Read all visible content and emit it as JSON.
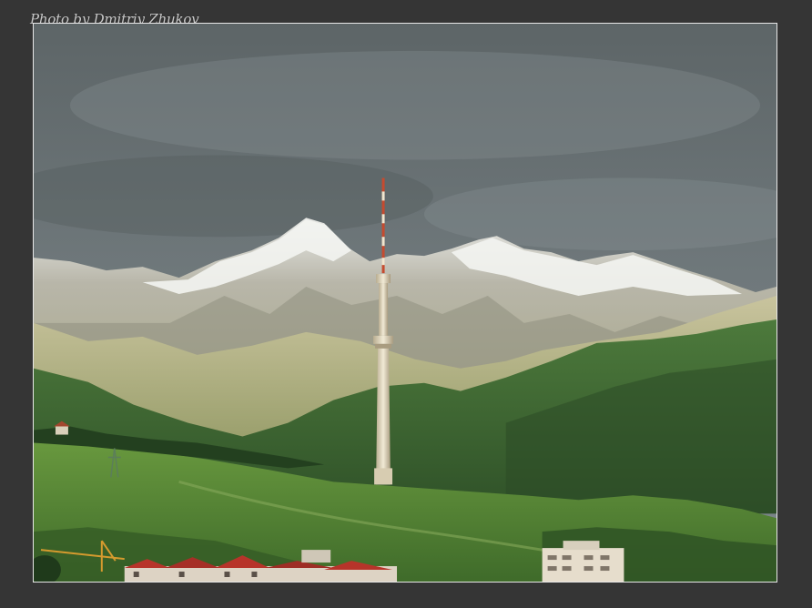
{
  "watermark": {
    "text": "Photo by Dmitriy Zhukov"
  },
  "colors": {
    "background": "#353535",
    "frame_border": "#e8e8e8",
    "sky": "#6b7476",
    "mountain_snow": "#e9ebe8",
    "forest": "#3f6536",
    "meadow": "#5f8e3a",
    "roof": "#b8342b",
    "tower": "#e6ddc6",
    "tower_mast": "#c84a2d"
  },
  "scene": {
    "subject_icon": "tv-tower-icon"
  }
}
